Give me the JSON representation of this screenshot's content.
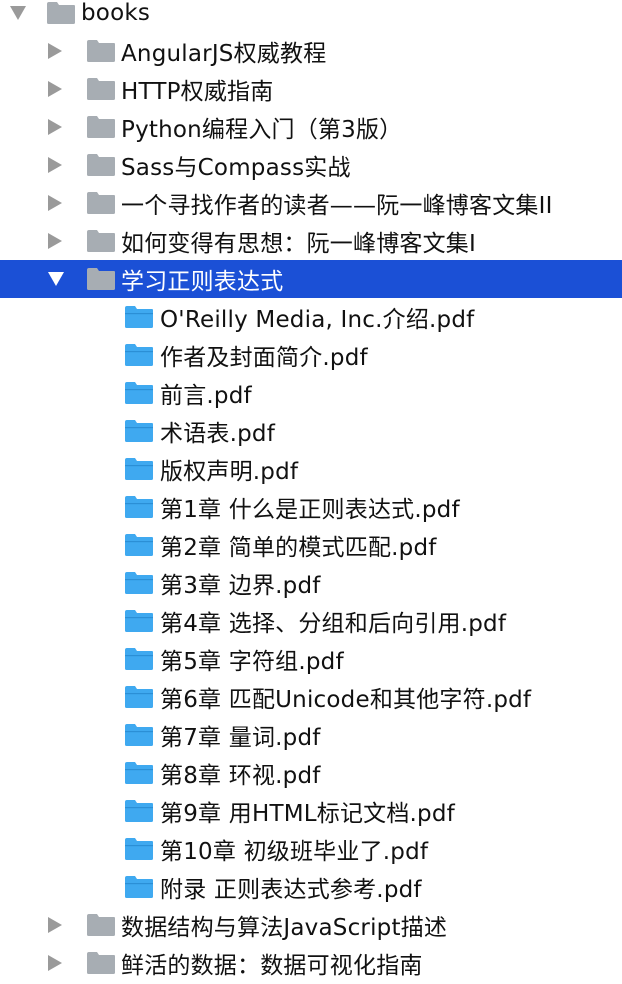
{
  "root": {
    "label": "books",
    "expanded": true,
    "children": [
      {
        "label": "AngularJS权威教程",
        "expanded": false
      },
      {
        "label": "HTTP权威指南",
        "expanded": false
      },
      {
        "label": "Python编程入门（第3版）",
        "expanded": false
      },
      {
        "label": "Sass与Compass实战",
        "expanded": false
      },
      {
        "label": "一个寻找作者的读者——阮一峰博客文集II",
        "expanded": false
      },
      {
        "label": "如何变得有思想：阮一峰博客文集I",
        "expanded": false
      },
      {
        "label": "学习正则表达式",
        "expanded": true,
        "selected": true,
        "children": [
          {
            "label": "O'Reilly Media, Inc.介绍.pdf"
          },
          {
            "label": "作者及封面简介.pdf"
          },
          {
            "label": "前言.pdf"
          },
          {
            "label": "术语表.pdf"
          },
          {
            "label": "版权声明.pdf"
          },
          {
            "label": "第1章 什么是正则表达式.pdf"
          },
          {
            "label": "第2章 简单的模式匹配.pdf"
          },
          {
            "label": "第3章 边界.pdf"
          },
          {
            "label": "第4章 选择、分组和后向引用.pdf"
          },
          {
            "label": "第5章 字符组.pdf"
          },
          {
            "label": "第6章 匹配Unicode和其他字符.pdf"
          },
          {
            "label": "第7章 量词.pdf"
          },
          {
            "label": "第8章 环视.pdf"
          },
          {
            "label": "第9章 用HTML标记文档.pdf"
          },
          {
            "label": "第10章 初级班毕业了.pdf"
          },
          {
            "label": "附录 正则表达式参考.pdf"
          }
        ]
      },
      {
        "label": "数据结构与算法JavaScript描述",
        "expanded": false
      },
      {
        "label": "鲜活的数据：数据可视化指南",
        "expanded": false
      }
    ]
  },
  "colors": {
    "selection": "#1b50d6",
    "gray_folder": "#a7adb3",
    "blue_folder": "#3fa9f0",
    "disclosure": "#9a9a9a"
  },
  "icons": {
    "gray_folder": "folder-icon",
    "blue_folder": "folder-blue-icon",
    "collapsed": "disclosure-right-icon",
    "expanded": "disclosure-down-icon"
  }
}
